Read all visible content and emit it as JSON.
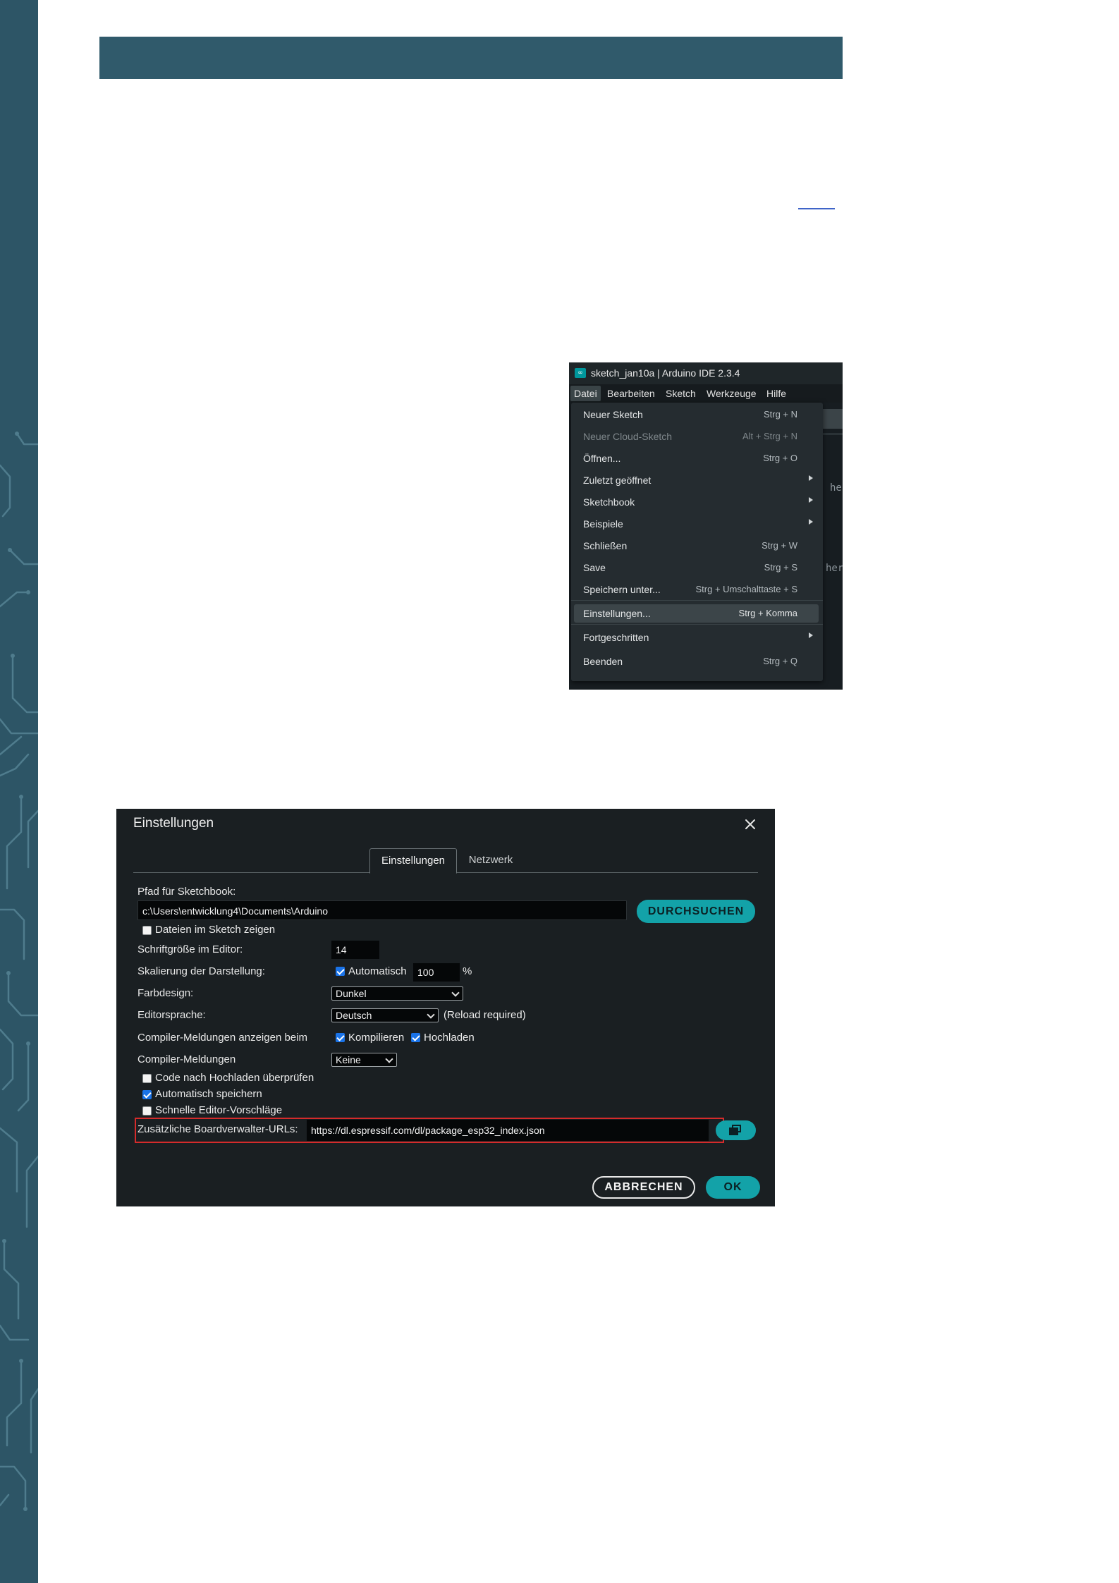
{
  "ide_window": {
    "title": "sketch_jan10a | Arduino IDE 2.3.4",
    "app_icon_glyph": "∞",
    "menubar": [
      "Datei",
      "Bearbeiten",
      "Sketch",
      "Werkzeuge",
      "Hilfe"
    ],
    "background_peek": [
      "he",
      "her"
    ],
    "file_menu": [
      {
        "label": "Neuer Sketch",
        "shortcut": "Strg + N",
        "disabled": false,
        "submenu": false,
        "selected": false
      },
      {
        "label": "Neuer Cloud-Sketch",
        "shortcut": "Alt + Strg + N",
        "disabled": true,
        "submenu": false,
        "selected": false
      },
      {
        "label": "Öffnen...",
        "shortcut": "Strg + O",
        "disabled": false,
        "submenu": false,
        "selected": false
      },
      {
        "label": "Zuletzt geöffnet",
        "shortcut": "",
        "disabled": false,
        "submenu": true,
        "selected": false
      },
      {
        "label": "Sketchbook",
        "shortcut": "",
        "disabled": false,
        "submenu": true,
        "selected": false
      },
      {
        "label": "Beispiele",
        "shortcut": "",
        "disabled": false,
        "submenu": true,
        "selected": false
      },
      {
        "label": "Schließen",
        "shortcut": "Strg + W",
        "disabled": false,
        "submenu": false,
        "selected": false
      },
      {
        "label": "Save",
        "shortcut": "Strg + S",
        "disabled": false,
        "submenu": false,
        "selected": false
      },
      {
        "label": "Speichern unter...",
        "shortcut": "Strg + Umschalttaste + S",
        "disabled": false,
        "submenu": false,
        "selected": false
      },
      {
        "label": "Einstellungen...",
        "shortcut": "Strg + Komma",
        "disabled": false,
        "submenu": false,
        "selected": true
      },
      {
        "label": "Fortgeschritten",
        "shortcut": "",
        "disabled": false,
        "submenu": true,
        "selected": false
      },
      {
        "label": "Beenden",
        "shortcut": "Strg + Q",
        "disabled": false,
        "submenu": false,
        "selected": false
      }
    ]
  },
  "settings_dialog": {
    "title": "Einstellungen",
    "tabs": [
      "Einstellungen",
      "Netzwerk"
    ],
    "active_tab": "Einstellungen",
    "sketchbook_path_label": "Pfad für Sketchbook:",
    "sketchbook_path_value": "c:\\Users\\entwicklung4\\Documents\\Arduino",
    "browse_label": "DURCHSUCHEN",
    "show_files_label": "Dateien im Sketch zeigen",
    "show_files_checked": false,
    "font_size_label": "Schriftgröße im Editor:",
    "font_size_value": "14",
    "scaling_label": "Skalierung der Darstellung:",
    "auto_scale_label": "Automatisch",
    "auto_scale_checked": true,
    "scale_value": "100",
    "scale_unit": "%",
    "theme_label": "Farbdesign:",
    "theme_value": "Dunkel",
    "language_label": "Editorsprache:",
    "language_value": "Deutsch",
    "language_note": "(Reload required)",
    "verbose_label": "Compiler-Meldungen anzeigen beim",
    "verbose_compile_label": "Kompilieren",
    "verbose_compile_checked": true,
    "verbose_upload_label": "Hochladen",
    "verbose_upload_checked": true,
    "warnings_label": "Compiler-Meldungen",
    "warnings_value": "Keine",
    "verify_label": "Code nach Hochladen überprüfen",
    "verify_checked": false,
    "autosave_label": "Automatisch speichern",
    "autosave_checked": true,
    "quick_suggest_label": "Schnelle Editor-Vorschläge",
    "quick_suggest_checked": false,
    "board_urls_label": "Zusätzliche Boardverwalter-URLs:",
    "board_urls_value": "https://dl.espressif.com/dl/package_esp32_index.json",
    "cancel_label": "ABBRECHEN",
    "ok_label": "OK"
  },
  "colors": {
    "strip": "#2d5566",
    "header_bar": "#305a6b",
    "accent_teal": "#13a2a8",
    "highlight_red": "#d42b2b",
    "dialog_bg": "#1a1f22"
  },
  "icons": {
    "dialog_close": "close-icon",
    "open_urls": "external-window-icon",
    "menu_submenu": "chevron-right-icon",
    "select_dropdown": "chevron-down-icon"
  }
}
